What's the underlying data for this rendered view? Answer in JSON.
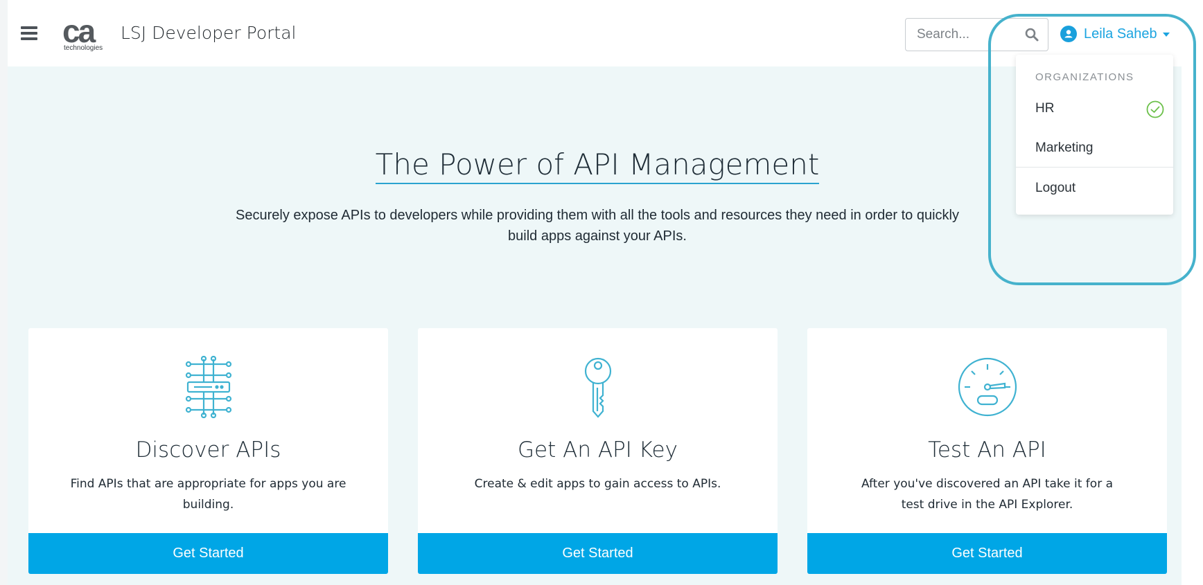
{
  "header": {
    "logo_text": "ca",
    "logo_subtext": "technologies",
    "portal_title": "LSJ Developer Portal",
    "search_placeholder": "Search...",
    "user_name": "Leila Saheb"
  },
  "hero": {
    "title": "The Power of API Management",
    "subtitle": "Securely expose APIs to developers while providing them with all the tools and resources they need in order to quickly build apps against your APIs."
  },
  "cards": [
    {
      "icon": "circuit-icon",
      "title": "Discover APIs",
      "description": "Find APIs that are appropriate for apps you are building.",
      "button": "Get Started"
    },
    {
      "icon": "key-icon",
      "title": "Get An API Key",
      "description": "Create & edit apps to gain access to APIs.",
      "button": "Get Started"
    },
    {
      "icon": "speedometer-icon",
      "title": "Test An API",
      "description": "After you've discovered an API take it for a test drive in the API Explorer.",
      "button": "Get Started"
    }
  ],
  "user_dropdown": {
    "header": "ORGANIZATIONS",
    "items": [
      "HR",
      "Marketing"
    ],
    "selected": "HR",
    "logout": "Logout"
  },
  "colors": {
    "accent": "#00a6e6",
    "link": "#1ba4e0",
    "hero_background": "#eef7f8",
    "highlight": "#46b2cc",
    "check": "#6cc04a"
  }
}
